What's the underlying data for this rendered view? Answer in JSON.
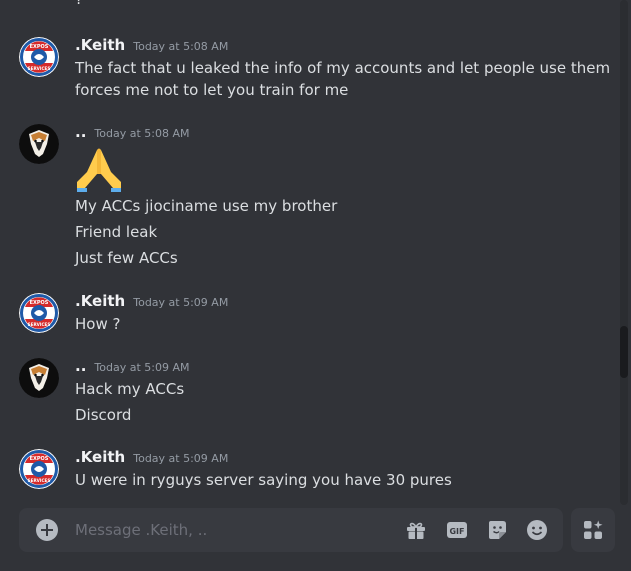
{
  "chat": {
    "fragment_above": "?",
    "groups": [
      {
        "user": ".Keith",
        "time": "Today at 5:08 AM",
        "lines": [
          "The fact that u leaked the info of my accounts and let people use them",
          "forces me not to let you train for me"
        ]
      },
      {
        "user": "..",
        "time": "Today at 5:08 AM",
        "emoji": "🙏",
        "lines": [
          "My ACCs jiociname use my brother",
          "Friend leak",
          "Just few ACCs"
        ]
      },
      {
        "user": ".Keith",
        "time": "Today at 5:09 AM",
        "lines": [
          "How ?"
        ]
      },
      {
        "user": "..",
        "time": "Today at 5:09 AM",
        "lines": [
          "Hack my ACCs",
          "Discord"
        ]
      },
      {
        "user": ".Keith",
        "time": "Today at 5:09 AM",
        "lines": [
          "U were in ryguys server saying you have 30 pures"
        ]
      }
    ]
  },
  "avatar_logo_text": {
    "top": "EXPOS",
    "bottom": "SERVICES"
  },
  "composer": {
    "placeholder": "Message .Keith, ..",
    "icons": [
      "add-icon",
      "gift-icon",
      "gif-icon",
      "sticker-icon",
      "emoji-icon",
      "apps-icon"
    ],
    "gif_label": "GIF"
  },
  "colors": {
    "background": "#313338",
    "composer": "#383a40",
    "username": "#f2f3f5",
    "timestamp": "#949ba4",
    "text": "#dbdee1",
    "placeholder": "#6d6f78",
    "icon": "#b5bac1"
  }
}
